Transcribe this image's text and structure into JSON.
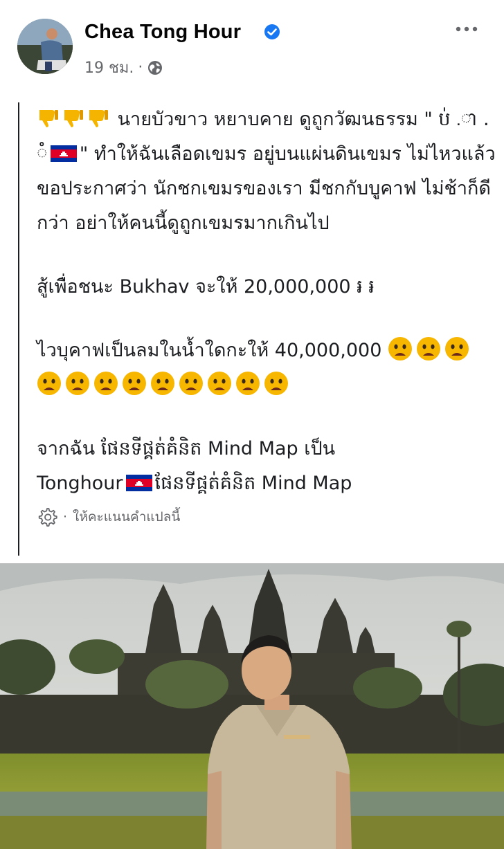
{
  "post": {
    "author": "Chea Tong Hour",
    "time": "19 ชม.",
    "separator": "·",
    "paragraphs": {
      "p1a": "นายบัวขาว หยาบคาย ดูถูกวัฒนธรรม",
      "p1b": "\" ប់ .ា . ◌ំ",
      "p1c": "\" ทำให้ฉันเลือดเขมร อยู่บนแผ่นดินเขมร ไม่ไหวแล้ว ขอประกาศว่า นักชกเขมรของเรา มีชกกับบูคาฟ ไม่ช้าก็ดีกว่า อย่าให้คนนี้ดูถูกเขมรมากเกินไป",
      "p2": "สู้เพื่อชนะ Bukhav จะให้ 20,000,000 ៛ ៛",
      "p3": "ไวบุคาฟเป็นลมในน้ำใดกะให้ 40,000,000",
      "p4a": "จากฉัน ផែនទីផ្គត់គំនិត Mind Map เป็น",
      "p4b": "Tonghour",
      "p4c": "ផែនទីផ្គត់គំនិត Mind Map"
    },
    "translate_label": "ให้คะแนนคำแปลนี้"
  },
  "icons": {
    "verified": "verified-badge-icon",
    "globe": "globe-icon",
    "more": "more-options-icon",
    "thumbs_down": "thumbs-down-emoji",
    "flag": "cambodia-flag-icon",
    "sad": "worried-face-emoji",
    "gear": "gear-icon"
  },
  "colors": {
    "verified_blue": "#1877f2",
    "text": "#1c1e21",
    "secondary": "#65676b"
  }
}
